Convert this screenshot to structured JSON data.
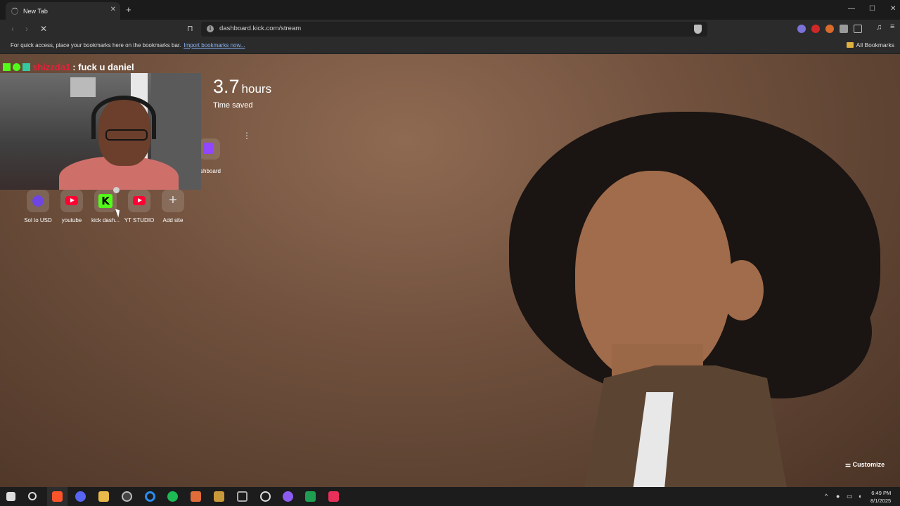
{
  "browser": {
    "tab_title": "New Tab",
    "url": "dashboard.kick.com/stream",
    "bookmarks_hint": "For quick access, place your bookmarks here on the bookmarks bar.",
    "import_link": "Import bookmarks now...",
    "all_bookmarks": "All Bookmarks"
  },
  "overlay": {
    "chat_user": "shizzda1",
    "chat_message": ": fuck u daniel"
  },
  "new_tab": {
    "stat_value": "3.7",
    "stat_unit": "hours",
    "stat_label": "Time saved",
    "partial_tile_label": "shboard",
    "shortcuts": [
      {
        "label": "Sol to USD",
        "icon": "kraken-icon"
      },
      {
        "label": "youtube",
        "icon": "youtube-icon"
      },
      {
        "label": "kick dash...",
        "icon": "kick-icon"
      },
      {
        "label": "YT STUDIO",
        "icon": "youtube-icon"
      },
      {
        "label": "Add site",
        "icon": "plus-icon"
      }
    ],
    "customize": "Customize"
  },
  "taskbar": {
    "time": "6:49 PM",
    "date": "8/1/2025"
  },
  "colors": {
    "kick_green": "#53fc18",
    "youtube_red": "#ff0033",
    "twitch_purple": "#9146ff",
    "chat_user_red": "#e8203a"
  }
}
